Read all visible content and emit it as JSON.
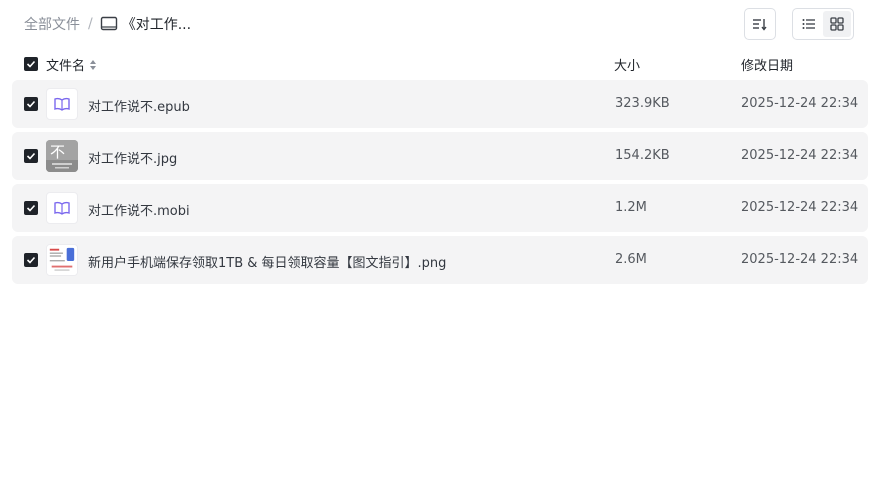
{
  "breadcrumb": {
    "root": "全部文件",
    "separator": "/",
    "current": "《对工作..."
  },
  "header": {
    "name": "文件名",
    "size": "大小",
    "date": "修改日期"
  },
  "files": [
    {
      "name": "对工作说不.epub",
      "size": "323.9KB",
      "date": "2025-12-24 22:34",
      "icon": "ebook-icon",
      "checked": true
    },
    {
      "name": "对工作说不.jpg",
      "size": "154.2KB",
      "date": "2025-12-24 22:34",
      "icon": "image-thumbnail",
      "thumb_text": "不",
      "checked": true
    },
    {
      "name": "对工作说不.mobi",
      "size": "1.2M",
      "date": "2025-12-24 22:34",
      "icon": "ebook-icon",
      "checked": true
    },
    {
      "name": "新用户手机端保存领取1TB & 每日领取容量【图文指引】.png",
      "size": "2.6M",
      "date": "2025-12-24 22:34",
      "icon": "image-thumbnail",
      "checked": true
    }
  ],
  "colors": {
    "accent": "#7b68ee",
    "row_bg": "#f4f4f5",
    "checkbox": "#1f2329"
  }
}
